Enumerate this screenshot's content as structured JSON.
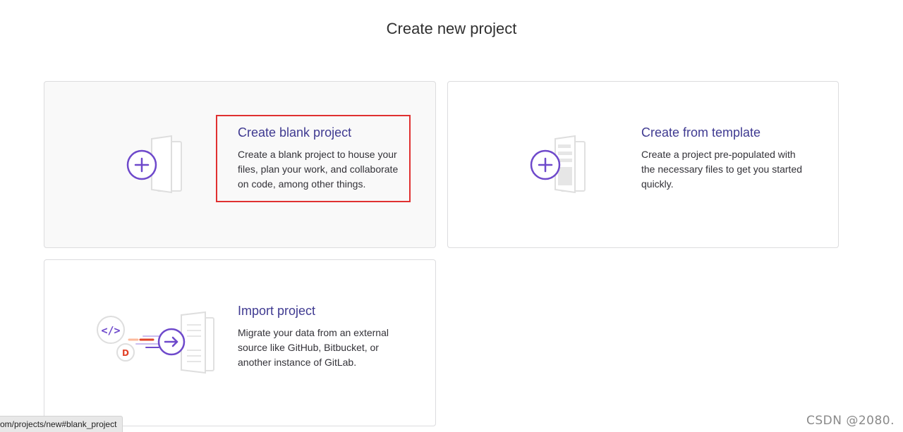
{
  "page": {
    "title": "Create new project"
  },
  "cards": {
    "blank": {
      "title": "Create blank project",
      "description": "Create a blank project to house your files, plan your work, and collaborate on code, among other things."
    },
    "template": {
      "title": "Create from template",
      "description": "Create a project pre-populated with the necessary files to get you started quickly."
    },
    "import": {
      "title": "Import project",
      "description": "Migrate your data from an external source like GitHub, Bitbucket, or another instance of GitLab."
    }
  },
  "status_bar": {
    "url": "om/projects/new#blank_project"
  },
  "watermark": {
    "text": "CSDN @2080."
  },
  "colors": {
    "accent": "#3f3a91",
    "illustration_purple": "#6e49cb",
    "highlight": "#e03131",
    "orange": "#e24329"
  },
  "icons": {
    "blank": "plus-in-document-icon",
    "template": "plus-in-template-document-icon",
    "import": "arrow-into-document-icon"
  }
}
